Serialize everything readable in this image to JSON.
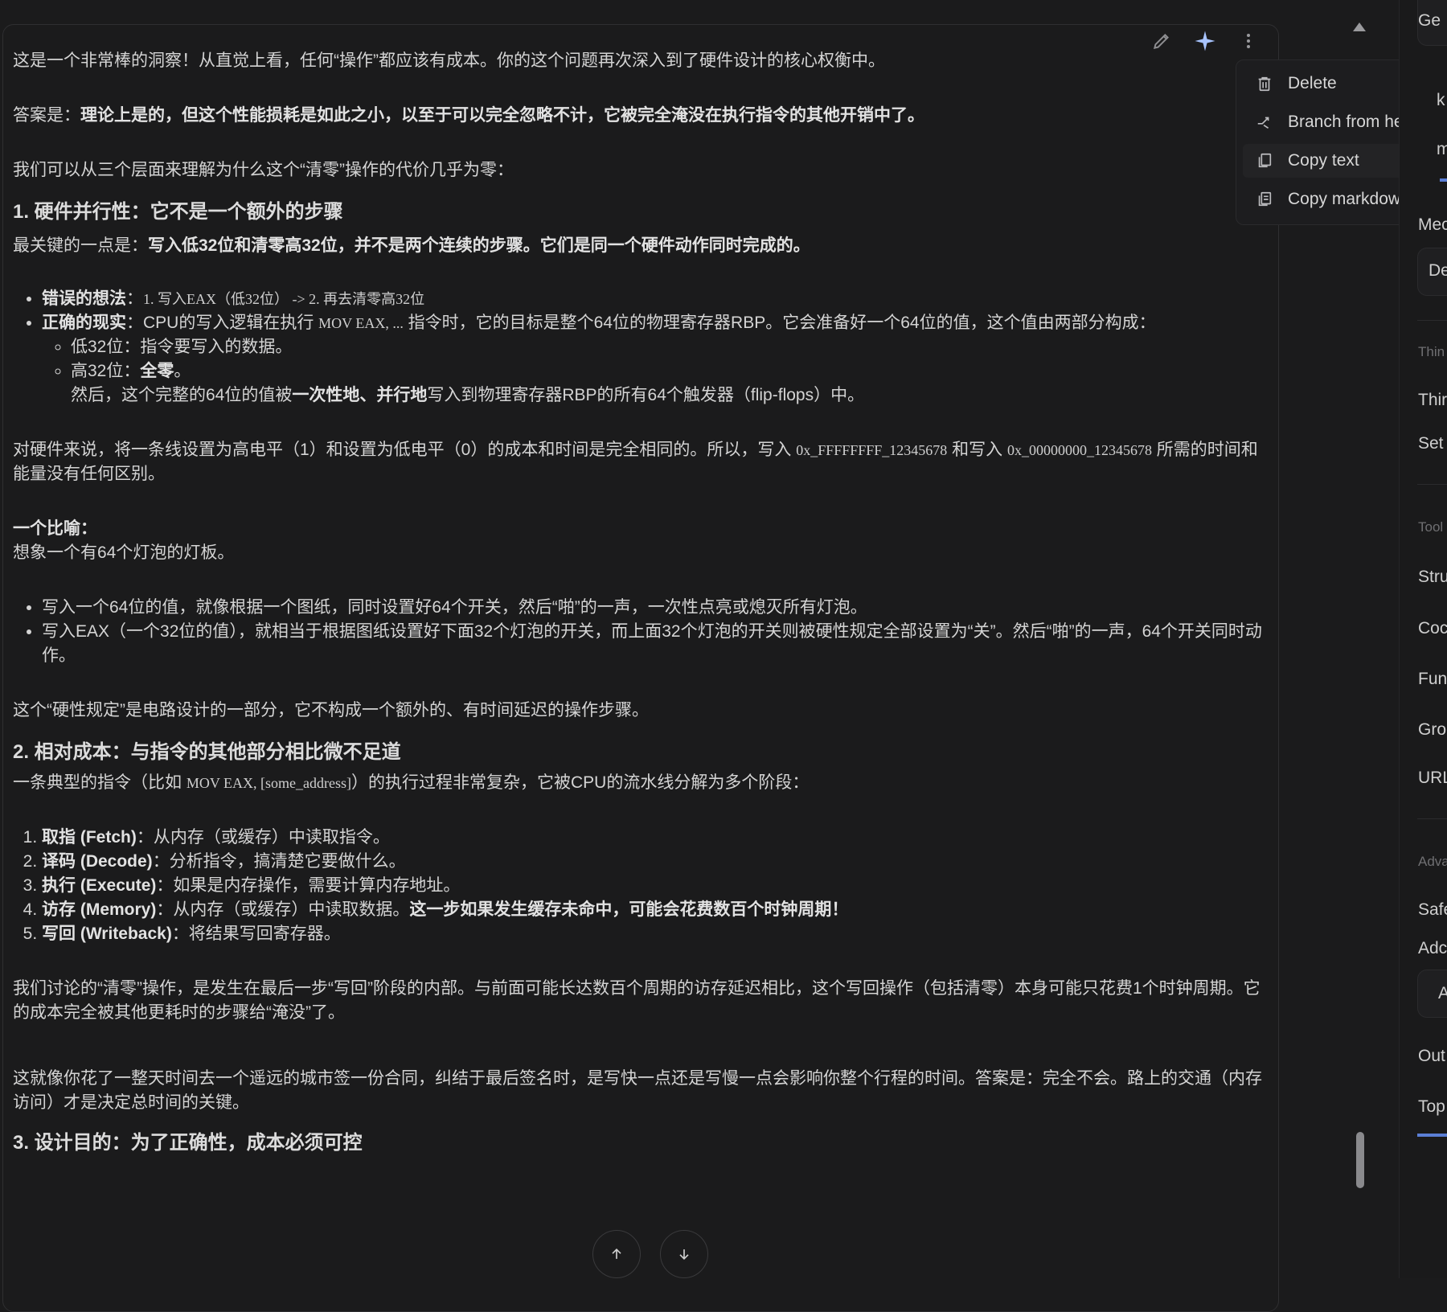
{
  "actions": {
    "edit_icon": "pencil-icon",
    "sparkle_icon": "sparkle-icon",
    "more_icon": "more-vertical-icon"
  },
  "menu": {
    "delete": "Delete",
    "branch": "Branch from here",
    "copy_text": "Copy text",
    "copy_markdown": "Copy markdown"
  },
  "message": {
    "p1": "这是一个非常棒的洞察！从直觉上看，任何“操作”都应该有成本。你的这个问题再次深入到了硬件设计的核心权衡中。",
    "p2_prefix": "答案是：",
    "p2_bold": "理论上是的，但这个性能损耗是如此之小，以至于可以完全忽略不计，它被完全淹没在执行指令的其他开销中了。",
    "p3": "我们可以从三个层面来理解为什么这个“清零”操作的代价几乎为零：",
    "h1": "1. 硬件并行性：它不是一个额外的步骤",
    "p4_prefix": "最关键的一点是：",
    "p4_bold": "写入低32位和清零高32位，并不是两个连续的步骤。它们是同一个硬件动作同时完成的。",
    "b1_label": "错误的想法",
    "b1_colon": "：",
    "b1_code": "1. 写入EAX（低32位） -> 2. 再去清零高32位",
    "b2_label": "正确的现实",
    "b2_a": "：CPU的写入逻辑在执行 ",
    "b2_code": "MOV EAX, ...",
    "b2_b": " 指令时，它的目标是整个64位的物理寄存器RBP。它会准备好一个64位的值，这个值由两部分构成：",
    "sub1": "低32位：指令要写入的数据。",
    "sub2_prefix": "高32位：",
    "sub2_bold": "全零",
    "sub2_suffix": "。",
    "sub2_line2_a": "然后，这个完整的64位的值被",
    "sub2_line2_bold": "一次性地、并行地",
    "sub2_line2_b": "写入到物理寄存器RBP的所有64个触发器（flip-flops）中。",
    "p5_a": "对硬件来说，将一条线设置为高电平（1）和设置为低电平（0）的成本和时间是完全相同的。所以，写入 ",
    "p5_code1": "0x_FFFFFFFF_12345678",
    "p5_b": " 和写入 ",
    "p5_code2": "0x_00000000_12345678",
    "p5_c": " 所需的时间和能量没有任何区别。",
    "analogy_title": "一个比喻：",
    "analogy_line": "想象一个有64个灯泡的灯板。",
    "a1": "写入一个64位的值，就像根据一个图纸，同时设置好64个开关，然后“啪”的一声，一次性点亮或熄灭所有灯泡。",
    "a2": "写入EAX（一个32位的值），就相当于根据图纸设置好下面32个灯泡的开关，而上面32个灯泡的开关则被硬性规定全部设置为“关”。然后“啪”的一声，64个开关同时动作。",
    "p6": "这个“硬性规定”是电路设计的一部分，它不构成一个额外的、有时间延迟的操作步骤。",
    "h2": "2. 相对成本：与指令的其他部分相比微不足道",
    "p7_a": "一条典型的指令（比如 ",
    "p7_code": "MOV EAX, [some_address]",
    "p7_b": "）的执行过程非常复杂，它被CPU的流水线分解为多个阶段：",
    "s1_bold": "取指 (Fetch)",
    "s1": "：从内存（或缓存）中读取指令。",
    "s2_bold": "译码 (Decode)",
    "s2": "：分析指令，搞清楚它要做什么。",
    "s3_bold": "执行 (Execute)",
    "s3": "：如果是内存操作，需要计算内存地址。",
    "s4_bold": "访存 (Memory)",
    "s4": "：从内存（或缓存）中读取数据。",
    "s4_bold2": "这一步如果发生缓存未命中，可能会花费数百个时钟周期！",
    "s5_bold": "写回 (Writeback)",
    "s5": "：将结果写回寄存器。",
    "p8": "我们讨论的“清零”操作，是发生在最后一步“写回”阶段的内部。与前面可能长达数百个周期的访存延迟相比，这个写回操作（包括清零）本身可能只花费1个时钟周期。它的成本完全被其他更耗时的步骤给“淹没”了。",
    "p9": "这就像你花了一整天时间去一个遥远的城市签一份合同，纠结于最后签名时，是写快一点还是写慢一点会影响你整个行程的时间。答案是：完全不会。路上的交通（内存访问）才是决定总时间的关键。",
    "h3": "3. 设计目的：为了正确性，成本必须可控"
  },
  "right_panel": {
    "r1": "Ge",
    "r2": "k",
    "r3": "m",
    "r4": "Mec",
    "r5": "De",
    "sec1": "Thin",
    "r6": "Thir",
    "r7": "Set",
    "sec2": "Tool",
    "r8": "Stru",
    "r9": "Coc",
    "r10": "Fun",
    "r11": "Gro",
    "r12": "URL",
    "sec3": "Adva",
    "r13": "Safe",
    "r14": "Adc",
    "r15": "A",
    "r16": "Out",
    "r17": "Top"
  },
  "colors": {
    "accent": "#5b7fd6",
    "background": "#1b1b1c",
    "text": "#d4d4d4"
  }
}
